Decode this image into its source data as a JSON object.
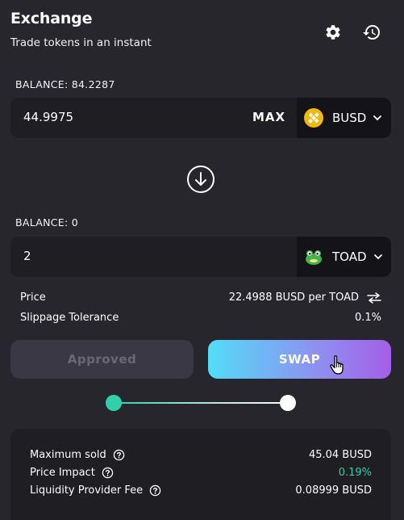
{
  "header": {
    "title": "Exchange",
    "subtitle": "Trade tokens in an instant",
    "settings_icon": "gear-icon",
    "history_icon": "history-icon"
  },
  "from": {
    "balance_label": "BALANCE: 84.2287",
    "amount": "44.9975",
    "max_label": "MAX",
    "token": "BUSD",
    "token_icon": "busd-logo-icon"
  },
  "switch_icon": "arrow-down-circle-icon",
  "to": {
    "balance_label": "BALANCE: 0",
    "amount": "2",
    "token": "TOAD",
    "token_icon": "toad-logo-icon"
  },
  "info": {
    "price_label": "Price",
    "price_value": "22.4988 BUSD per TOAD",
    "slippage_label": "Slippage Tolerance",
    "slippage_value": "0.1%"
  },
  "buttons": {
    "approved_label": "Approved",
    "swap_label": "SWAP"
  },
  "progress": {
    "step": 1,
    "total_steps": 2
  },
  "summary": {
    "max_sold_label": "Maximum sold",
    "max_sold_value": "45.04 BUSD",
    "price_impact_label": "Price Impact",
    "price_impact_value": "0.19%",
    "lp_fee_label": "Liquidity Provider Fee",
    "lp_fee_value": "0.08999 BUSD"
  },
  "colors": {
    "background": "#27262c",
    "panel": "#1f1e23",
    "accent_green": "#31d0aa",
    "busd_yellow": "#f0b90b"
  }
}
